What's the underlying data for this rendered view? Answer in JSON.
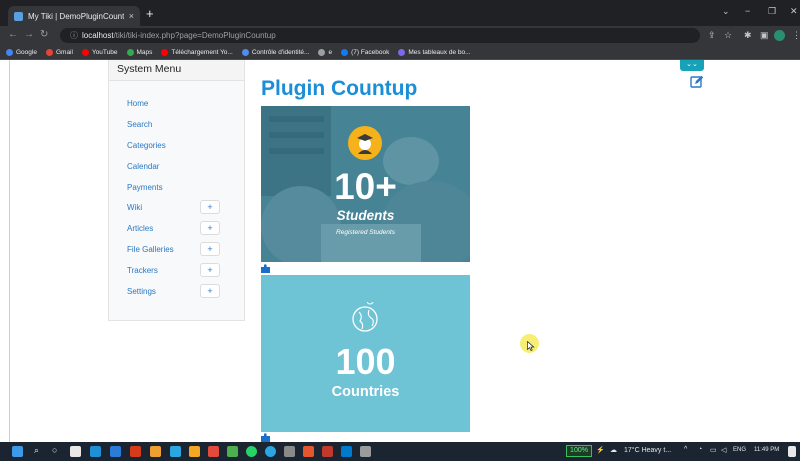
{
  "browser": {
    "tab_title": "My Tiki | DemoPluginCountup",
    "tab_close": "×",
    "new_tab": "+",
    "url_host": "localhost",
    "url_rest": "/tiki/tiki-index.php?page=DemoPluginCountup",
    "window_minimize": "−",
    "window_maximize": "❐",
    "window_close": "✕"
  },
  "bookmarks": [
    {
      "label": "Google",
      "color": "#4285f4"
    },
    {
      "label": "Gmail",
      "color": "#ea4335"
    },
    {
      "label": "YouTube",
      "color": "#ff0000"
    },
    {
      "label": "Maps",
      "color": "#34a853"
    },
    {
      "label": "Téléchargement Yo...",
      "color": "#ff0000"
    },
    {
      "label": "Contrôle d'identité...",
      "color": "#4d8ef0"
    },
    {
      "label": "e",
      "color": "#9aa0a6"
    },
    {
      "label": "(7) Facebook",
      "color": "#1877f2"
    },
    {
      "label": "Mes tableaux de bo...",
      "color": "#7b68ee"
    }
  ],
  "sidebar": {
    "title": "System Menu",
    "items": [
      {
        "label": "Home",
        "expandable": false
      },
      {
        "label": "Search",
        "expandable": false
      },
      {
        "label": "Categories",
        "expandable": false
      },
      {
        "label": "Calendar",
        "expandable": false
      },
      {
        "label": "Payments",
        "expandable": false
      },
      {
        "label": "Wiki",
        "expandable": true
      },
      {
        "label": "Articles",
        "expandable": true
      },
      {
        "label": "File Galleries",
        "expandable": true
      },
      {
        "label": "Trackers",
        "expandable": true
      },
      {
        "label": "Settings",
        "expandable": true
      }
    ],
    "expand_symbol": "+"
  },
  "page": {
    "title": "Plugin Countup",
    "top_button_symbol": "⌄⌄"
  },
  "cards": [
    {
      "number": "10+",
      "label": "Students",
      "sublabel": "Registered Students"
    },
    {
      "number": "100",
      "label": "Countries"
    }
  ],
  "taskbar": {
    "battery": "100%",
    "weather": "17°C  Heavy t...",
    "language": "ENG",
    "time": "11:49 PM"
  },
  "colors": {
    "title_blue": "#1a8ed8",
    "link_blue": "#2a78c5",
    "card1_overlay": "#4a8497",
    "card2_bg": "#6ec3d5",
    "badge_yellow": "#f6b21b",
    "accent_teal": "#17a2b8"
  }
}
